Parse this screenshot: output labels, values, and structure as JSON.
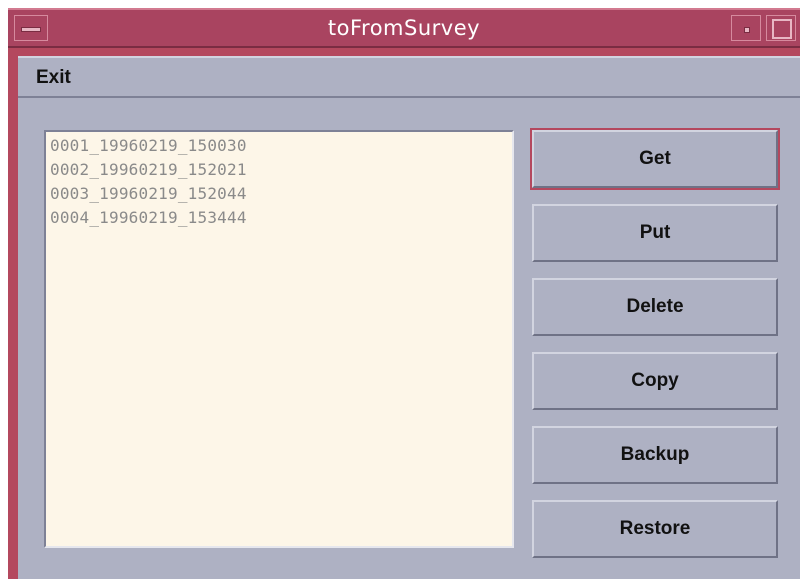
{
  "window": {
    "title": "toFromSurvey"
  },
  "menubar": {
    "items": [
      {
        "label": "Exit"
      }
    ]
  },
  "file_list": {
    "items": [
      "0001_19960219_150030",
      "0002_19960219_152021",
      "0003_19960219_152044",
      "0004_19960219_153444"
    ]
  },
  "buttons": {
    "get": "Get",
    "put": "Put",
    "delete": "Delete",
    "copy": "Copy",
    "backup": "Backup",
    "restore": "Restore"
  },
  "colors": {
    "titlebar": "#a94460",
    "window_bg": "#aeb1c3",
    "list_bg": "#fdf6e8"
  }
}
